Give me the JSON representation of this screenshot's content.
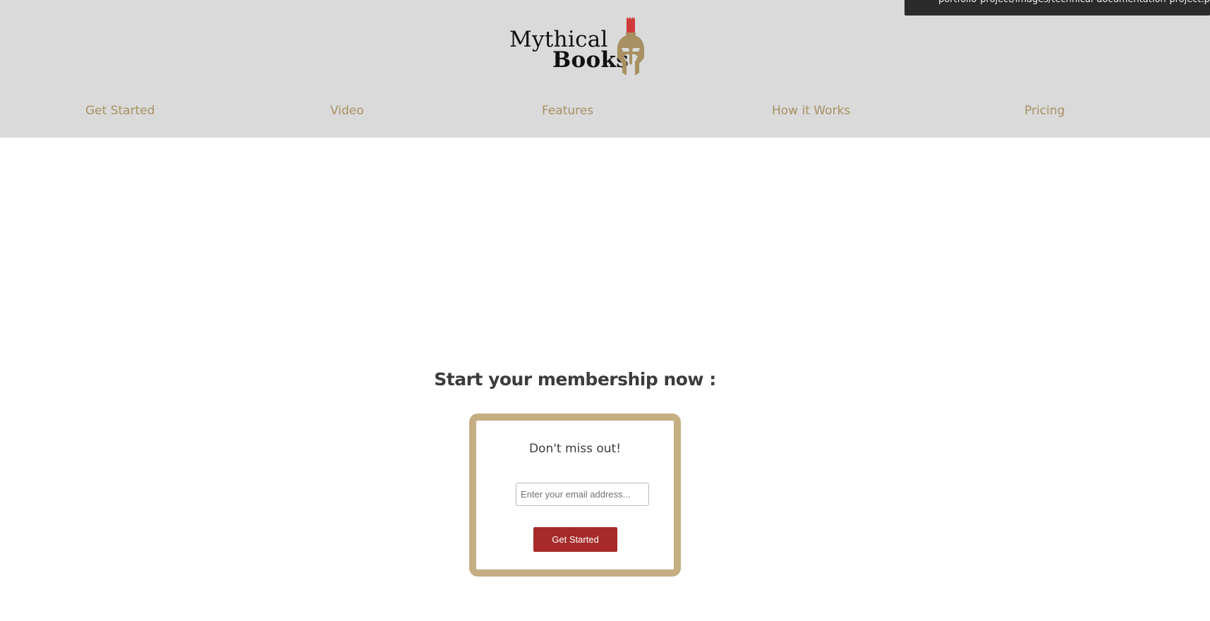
{
  "header": {
    "logo": {
      "line1": "Mythical",
      "line2": "Books",
      "icon": "spartan-helmet-icon"
    },
    "nav": [
      {
        "label": "Get Started"
      },
      {
        "label": "Video"
      },
      {
        "label": "Features"
      },
      {
        "label": "How it Works"
      },
      {
        "label": "Pricing"
      }
    ]
  },
  "tooltip": {
    "text": "portfolio-project/images/technical-documentation-project.png"
  },
  "membership": {
    "title": "Start your membership now :",
    "box_heading": "Don't miss out!",
    "email_placeholder": "Enter your email address...",
    "email_value": "",
    "submit_label": "Get Started"
  },
  "colors": {
    "header_bg": "#dadada",
    "nav_text": "#a89063",
    "box_border": "#c6ae83",
    "button_bg": "#a72a2a",
    "helmet_crest": "#d03a3a",
    "helmet_body": "#a89063"
  }
}
